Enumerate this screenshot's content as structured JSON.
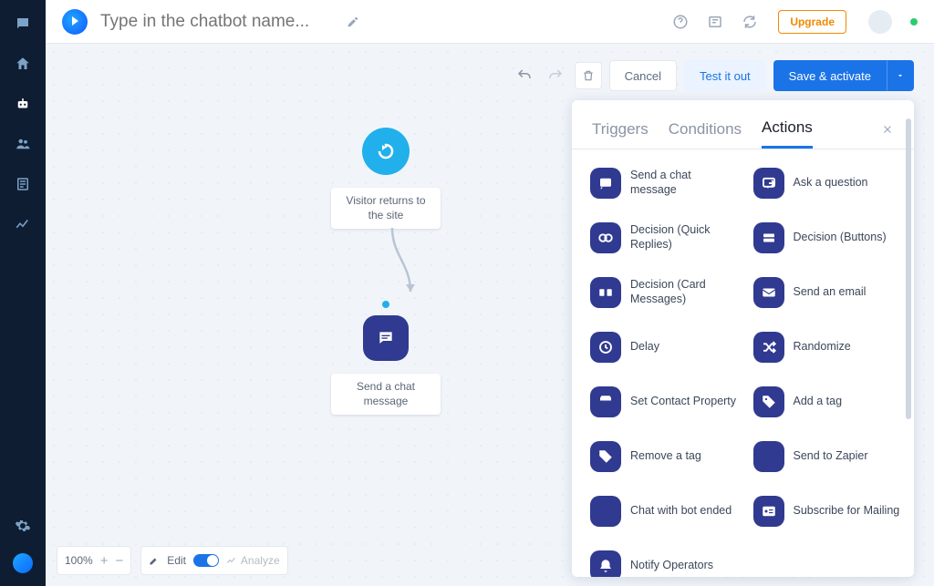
{
  "header": {
    "title_placeholder": "Type in the chatbot name...",
    "upgrade_label": "Upgrade"
  },
  "toolbar": {
    "cancel": "Cancel",
    "test": "Test it out",
    "save": "Save & activate"
  },
  "nodes": {
    "start_label": "Visitor returns to the site",
    "action_label": "Send a chat message"
  },
  "panel": {
    "tabs": {
      "triggers": "Triggers",
      "conditions": "Conditions",
      "actions": "Actions"
    },
    "actions_col1": [
      "Send a chat message",
      "Decision (Quick Replies)",
      "Decision (Card Messages)",
      "Delay",
      "Set Contact Property",
      "Remove a tag",
      "Chat with bot ended",
      "Notify Operators"
    ],
    "actions_col2": [
      "Ask a question",
      "Decision (Buttons)",
      "Send an email",
      "Randomize",
      "Add a tag",
      "Send to Zapier",
      "Subscribe for Mailing"
    ]
  },
  "footer": {
    "zoom": "100%",
    "edit": "Edit",
    "analyze": "Analyze"
  }
}
